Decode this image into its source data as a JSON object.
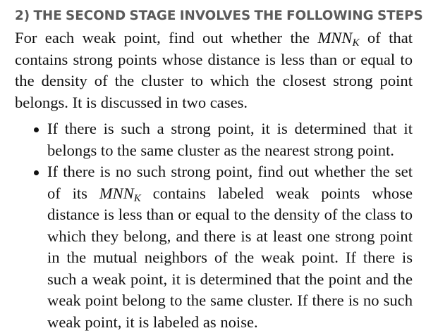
{
  "section": {
    "heading": "2) THE SECOND STAGE INVOLVES THE FOLLOWING STEPS"
  },
  "intro": {
    "text_before": "For each weak point, find out whether the ",
    "math_mnn": "MNN",
    "math_sub": "K",
    "text_after": " of that contains strong points whose distance is less than or equal to the density of the cluster to which the closest strong point belongs. It is discussed in two cases."
  },
  "bullets": [
    {
      "text": "If there is such a strong point, it is determined that it belongs to the same cluster as the nearest strong point."
    },
    {
      "text_before": "If there is no such strong point, find out whether the set of its ",
      "math_mnn": "MNN",
      "math_sub": "K",
      "text_after": " contains labeled weak points whose distance is less than or equal to the density of the class to which they belong, and there is at least one strong point in the mutual neighbors of the weak point. If there is such a weak point, it is determined that the point and the weak point belong to the same cluster. If there is no such weak point, it is labeled as noise."
    }
  ]
}
